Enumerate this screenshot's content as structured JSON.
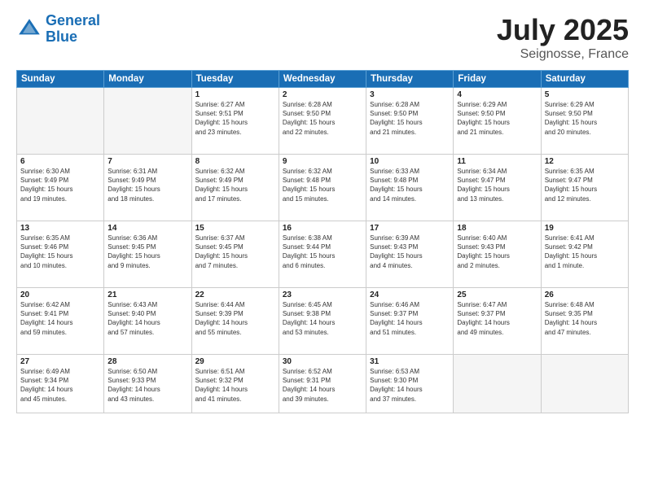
{
  "header": {
    "logo_line1": "General",
    "logo_line2": "Blue",
    "month": "July 2025",
    "location": "Seignosse, France"
  },
  "weekdays": [
    "Sunday",
    "Monday",
    "Tuesday",
    "Wednesday",
    "Thursday",
    "Friday",
    "Saturday"
  ],
  "weeks": [
    [
      {
        "day": "",
        "info": ""
      },
      {
        "day": "",
        "info": ""
      },
      {
        "day": "1",
        "info": "Sunrise: 6:27 AM\nSunset: 9:51 PM\nDaylight: 15 hours\nand 23 minutes."
      },
      {
        "day": "2",
        "info": "Sunrise: 6:28 AM\nSunset: 9:50 PM\nDaylight: 15 hours\nand 22 minutes."
      },
      {
        "day": "3",
        "info": "Sunrise: 6:28 AM\nSunset: 9:50 PM\nDaylight: 15 hours\nand 21 minutes."
      },
      {
        "day": "4",
        "info": "Sunrise: 6:29 AM\nSunset: 9:50 PM\nDaylight: 15 hours\nand 21 minutes."
      },
      {
        "day": "5",
        "info": "Sunrise: 6:29 AM\nSunset: 9:50 PM\nDaylight: 15 hours\nand 20 minutes."
      }
    ],
    [
      {
        "day": "6",
        "info": "Sunrise: 6:30 AM\nSunset: 9:49 PM\nDaylight: 15 hours\nand 19 minutes."
      },
      {
        "day": "7",
        "info": "Sunrise: 6:31 AM\nSunset: 9:49 PM\nDaylight: 15 hours\nand 18 minutes."
      },
      {
        "day": "8",
        "info": "Sunrise: 6:32 AM\nSunset: 9:49 PM\nDaylight: 15 hours\nand 17 minutes."
      },
      {
        "day": "9",
        "info": "Sunrise: 6:32 AM\nSunset: 9:48 PM\nDaylight: 15 hours\nand 15 minutes."
      },
      {
        "day": "10",
        "info": "Sunrise: 6:33 AM\nSunset: 9:48 PM\nDaylight: 15 hours\nand 14 minutes."
      },
      {
        "day": "11",
        "info": "Sunrise: 6:34 AM\nSunset: 9:47 PM\nDaylight: 15 hours\nand 13 minutes."
      },
      {
        "day": "12",
        "info": "Sunrise: 6:35 AM\nSunset: 9:47 PM\nDaylight: 15 hours\nand 12 minutes."
      }
    ],
    [
      {
        "day": "13",
        "info": "Sunrise: 6:35 AM\nSunset: 9:46 PM\nDaylight: 15 hours\nand 10 minutes."
      },
      {
        "day": "14",
        "info": "Sunrise: 6:36 AM\nSunset: 9:45 PM\nDaylight: 15 hours\nand 9 minutes."
      },
      {
        "day": "15",
        "info": "Sunrise: 6:37 AM\nSunset: 9:45 PM\nDaylight: 15 hours\nand 7 minutes."
      },
      {
        "day": "16",
        "info": "Sunrise: 6:38 AM\nSunset: 9:44 PM\nDaylight: 15 hours\nand 6 minutes."
      },
      {
        "day": "17",
        "info": "Sunrise: 6:39 AM\nSunset: 9:43 PM\nDaylight: 15 hours\nand 4 minutes."
      },
      {
        "day": "18",
        "info": "Sunrise: 6:40 AM\nSunset: 9:43 PM\nDaylight: 15 hours\nand 2 minutes."
      },
      {
        "day": "19",
        "info": "Sunrise: 6:41 AM\nSunset: 9:42 PM\nDaylight: 15 hours\nand 1 minute."
      }
    ],
    [
      {
        "day": "20",
        "info": "Sunrise: 6:42 AM\nSunset: 9:41 PM\nDaylight: 14 hours\nand 59 minutes."
      },
      {
        "day": "21",
        "info": "Sunrise: 6:43 AM\nSunset: 9:40 PM\nDaylight: 14 hours\nand 57 minutes."
      },
      {
        "day": "22",
        "info": "Sunrise: 6:44 AM\nSunset: 9:39 PM\nDaylight: 14 hours\nand 55 minutes."
      },
      {
        "day": "23",
        "info": "Sunrise: 6:45 AM\nSunset: 9:38 PM\nDaylight: 14 hours\nand 53 minutes."
      },
      {
        "day": "24",
        "info": "Sunrise: 6:46 AM\nSunset: 9:37 PM\nDaylight: 14 hours\nand 51 minutes."
      },
      {
        "day": "25",
        "info": "Sunrise: 6:47 AM\nSunset: 9:37 PM\nDaylight: 14 hours\nand 49 minutes."
      },
      {
        "day": "26",
        "info": "Sunrise: 6:48 AM\nSunset: 9:35 PM\nDaylight: 14 hours\nand 47 minutes."
      }
    ],
    [
      {
        "day": "27",
        "info": "Sunrise: 6:49 AM\nSunset: 9:34 PM\nDaylight: 14 hours\nand 45 minutes."
      },
      {
        "day": "28",
        "info": "Sunrise: 6:50 AM\nSunset: 9:33 PM\nDaylight: 14 hours\nand 43 minutes."
      },
      {
        "day": "29",
        "info": "Sunrise: 6:51 AM\nSunset: 9:32 PM\nDaylight: 14 hours\nand 41 minutes."
      },
      {
        "day": "30",
        "info": "Sunrise: 6:52 AM\nSunset: 9:31 PM\nDaylight: 14 hours\nand 39 minutes."
      },
      {
        "day": "31",
        "info": "Sunrise: 6:53 AM\nSunset: 9:30 PM\nDaylight: 14 hours\nand 37 minutes."
      },
      {
        "day": "",
        "info": ""
      },
      {
        "day": "",
        "info": ""
      }
    ]
  ]
}
